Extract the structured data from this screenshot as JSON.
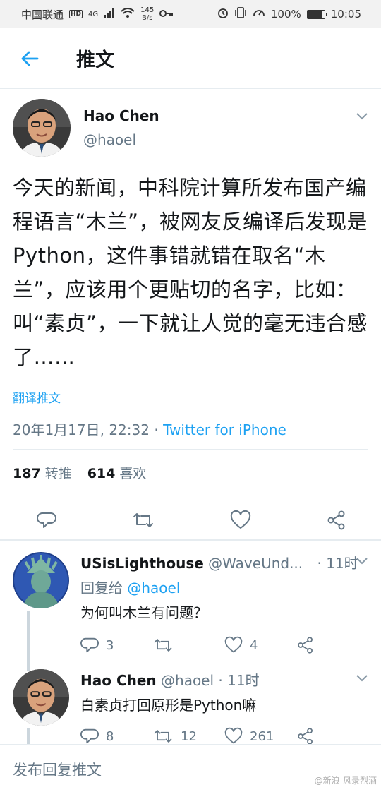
{
  "status_bar": {
    "carrier": "中国联通",
    "hd": "HD",
    "network": "4G",
    "speed_value": "145",
    "speed_unit": "B/s",
    "battery_percent": "100%",
    "time": "10:05"
  },
  "app_bar": {
    "title": "推文"
  },
  "tweet": {
    "display_name": "Hao Chen",
    "handle": "@haoel",
    "text": "今天的新闻，中科院计算所发布国产编程语言“木兰”，被网友反编译后发现是Python，这件事错就错在取名“木兰”，应该用个更贴切的名字，比如：叫“素贞”，一下就让人觉的毫无违合感了……",
    "translate_label": "翻译推文",
    "timestamp": "20年1月17日, 22:32",
    "separator": " · ",
    "source": "Twitter for iPhone",
    "retweets_count": "187",
    "retweets_label": "转推",
    "likes_count": "614",
    "likes_label": "喜欢"
  },
  "replies": [
    {
      "display_name": "USisLighthouse",
      "handle": "@WaveUnd...",
      "time": "· 11时",
      "reply_to_label": "回复给",
      "reply_to_handle": "@haoel",
      "text": "为何叫木兰有问题？",
      "reply_count": "3",
      "retweet_count": "",
      "like_count": "4"
    },
    {
      "display_name": "Hao Chen",
      "handle": "@haoel",
      "time": "· 11时",
      "text": "白素贞打回原形是Python嘛",
      "reply_count": "8",
      "retweet_count": "12",
      "like_count": "261"
    }
  ],
  "compose": {
    "placeholder": "发布回复推文"
  },
  "watermark": "@新浪-风录烈酒",
  "colors": {
    "accent": "#1da1f2",
    "muted": "#657786",
    "text": "#14171a",
    "border": "#e6ecf0"
  }
}
